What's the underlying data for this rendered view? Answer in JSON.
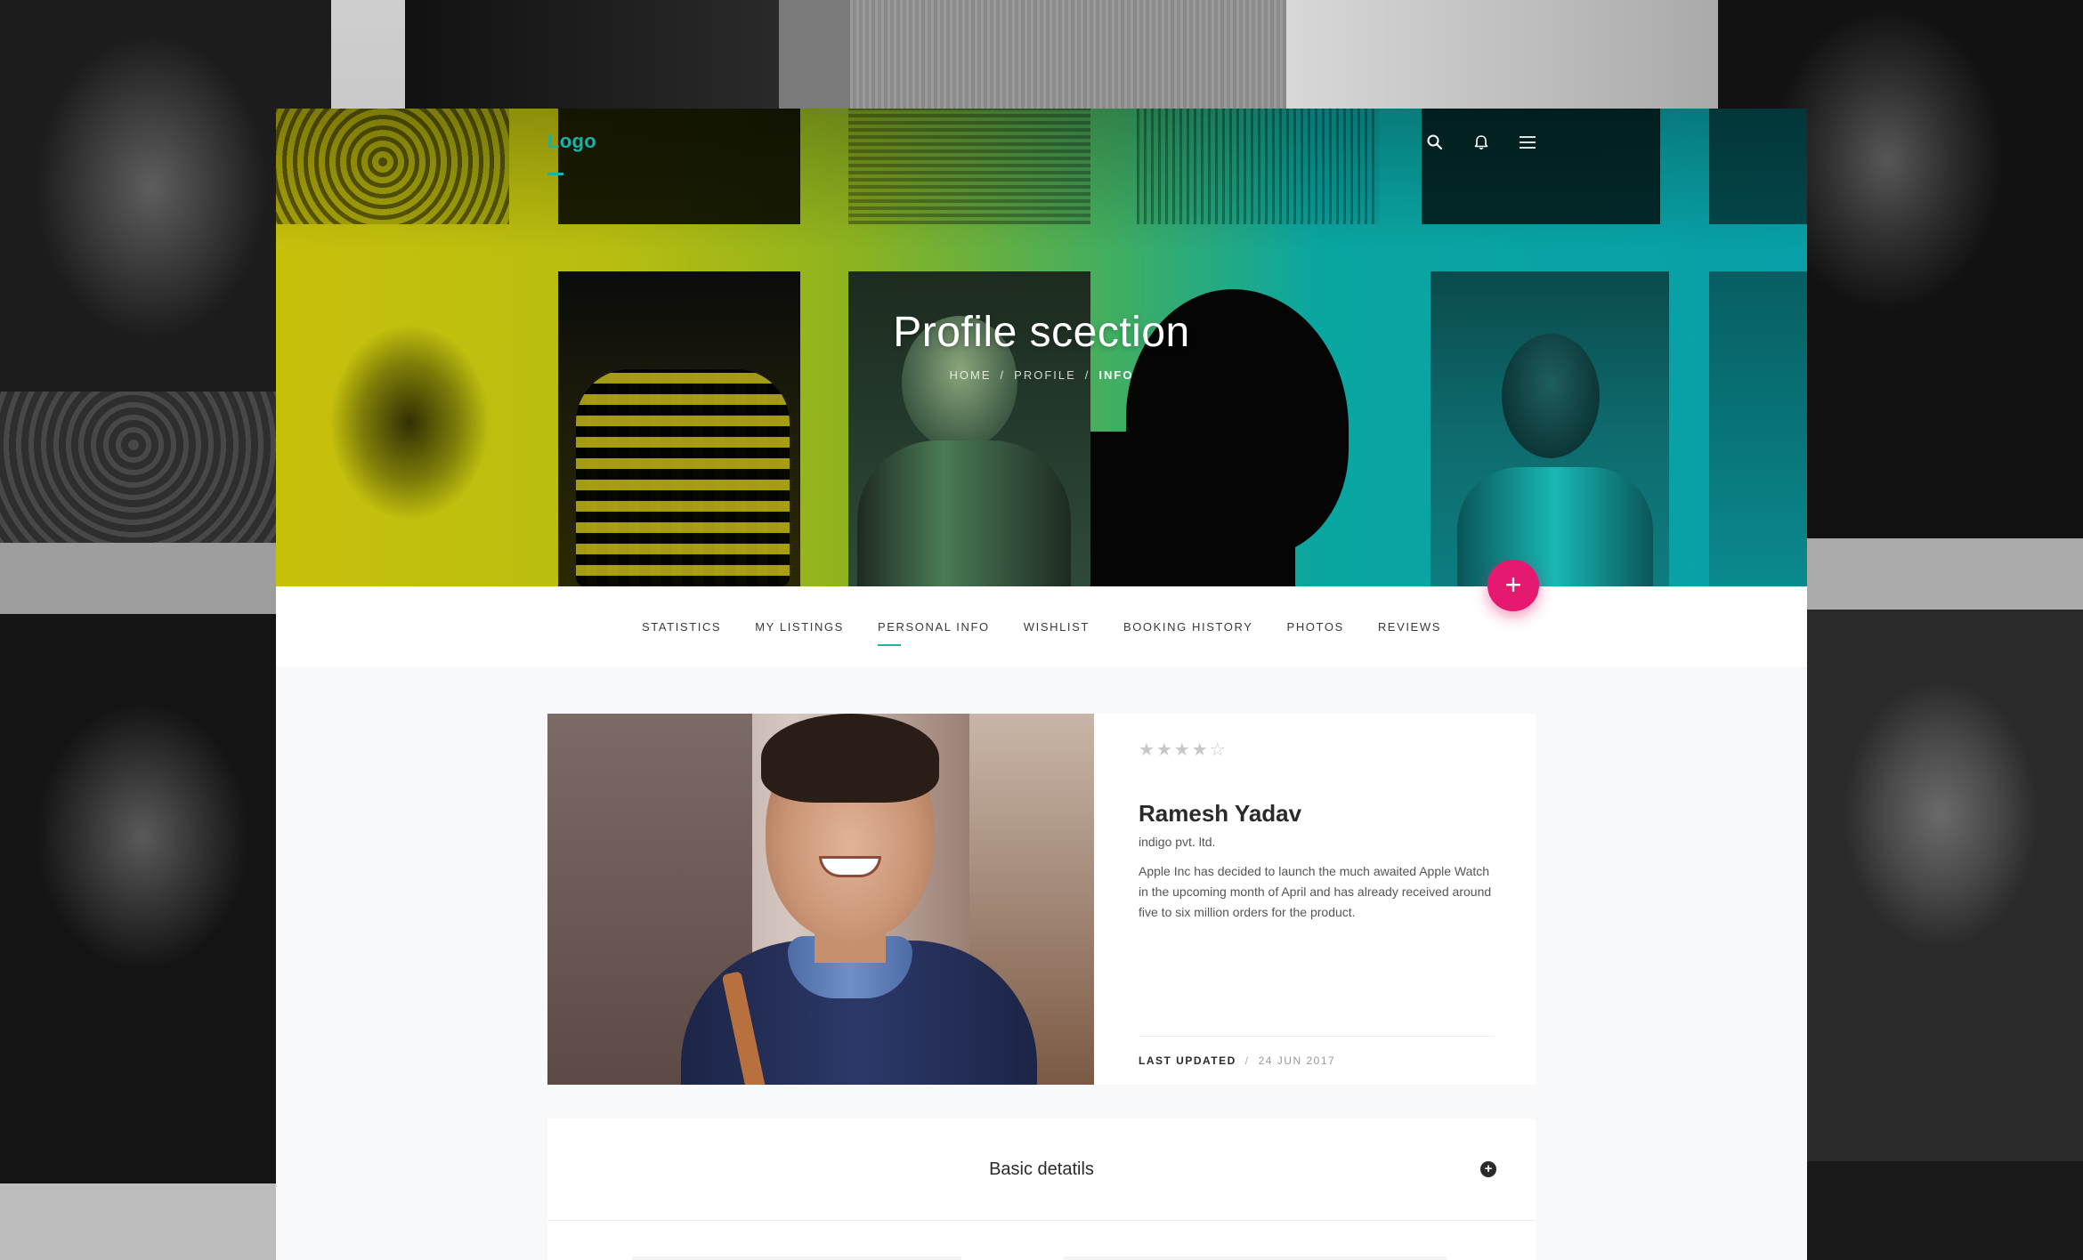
{
  "header": {
    "logo": "Logo",
    "icons": [
      "search-icon",
      "bell-icon",
      "menu-icon"
    ]
  },
  "hero": {
    "title": "Profile scection",
    "breadcrumb": [
      "HOME",
      "PROFILE",
      "INFO"
    ],
    "breadcrumb_separator": "/",
    "fab_label": "+"
  },
  "tabs": [
    {
      "label": "STATISTICS"
    },
    {
      "label": "MY LISTINGS"
    },
    {
      "label": "PERSONAL INFO",
      "active": true
    },
    {
      "label": "WISHLIST"
    },
    {
      "label": "BOOKING HISTORY"
    },
    {
      "label": "PHOTOS"
    },
    {
      "label": "REVIEWS"
    }
  ],
  "profile": {
    "rating": 4,
    "rating_max": 5,
    "stars": "★★★★☆",
    "name": "Ramesh Yadav",
    "company": "indigo pvt. ltd.",
    "description": "Apple Inc has decided to launch the much awaited Apple Watch in the upcoming month of April and has already received around five to six million orders for the product.",
    "last_updated_label": "LAST UPDATED",
    "separator": "/",
    "last_updated_date": "24 JUN 2017"
  },
  "details": {
    "title": "Basic detatils",
    "toggle": "+"
  },
  "colors": {
    "accent": "#19b3a6",
    "fab": "#e5196f",
    "text": "#2a2a2a"
  }
}
